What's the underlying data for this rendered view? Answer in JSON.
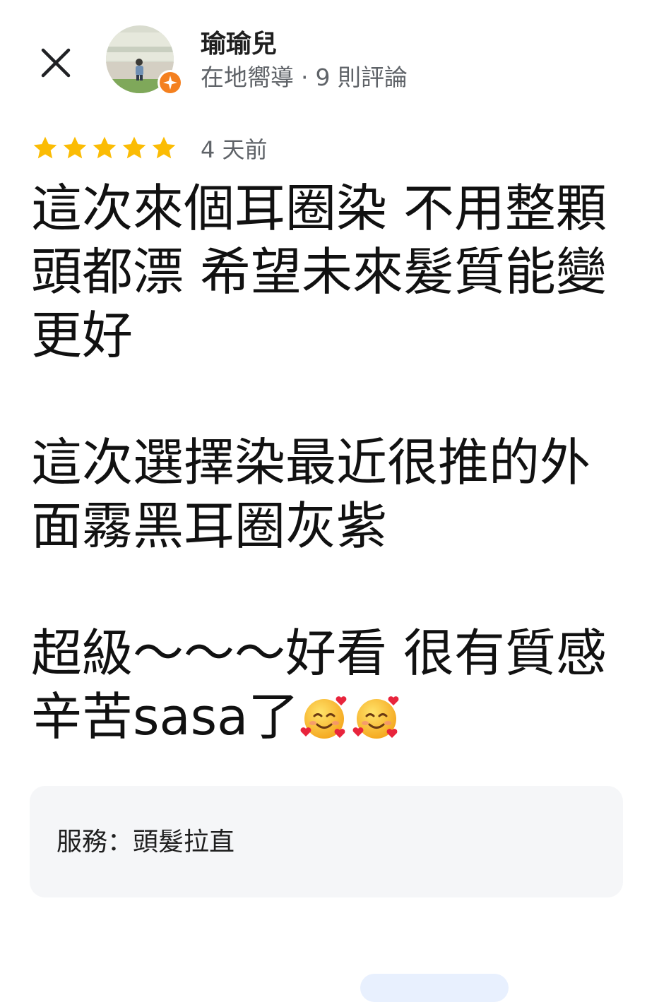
{
  "author": {
    "name": "瑜瑜兒",
    "role": "在地嚮導",
    "separator": "·",
    "review_count": "9 則評論",
    "avatar_icon": "profile-photo",
    "badge_icon": "local-guide-star-icon",
    "badge_color": "#f4801f"
  },
  "review": {
    "rating": 5,
    "rating_max": 5,
    "star_color": "#fbbc04",
    "time": "4 天前",
    "text_before_emoji": "這次來個耳圈染 不用整顆頭都漂 希望未來髮質能變更好\n\n這次選擇染最近很推的外面霧黑耳圈灰紫\n\n超級～～～好看 很有質感 辛苦sasa了",
    "emojis": [
      "smiling-face-with-hearts",
      "smiling-face-with-hearts"
    ]
  },
  "service": {
    "text": "服務：頭髮拉直"
  },
  "close_icon": "close-icon"
}
